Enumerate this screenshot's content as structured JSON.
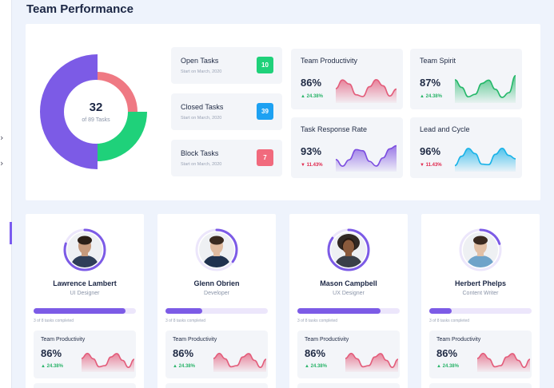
{
  "page": {
    "title": "Team Performance"
  },
  "summary": {
    "completed": "32",
    "of_label": "of 89 Tasks",
    "segments": [
      {
        "name": "purple",
        "color": "#7c5be6",
        "start_deg": 180,
        "end_deg": 360
      },
      {
        "name": "red",
        "color": "#ef7983",
        "start_deg": 0,
        "end_deg": 90
      },
      {
        "name": "green",
        "color": "#1fd17a",
        "start_deg": 90,
        "end_deg": 180
      }
    ]
  },
  "tasks": [
    {
      "title": "Open Tasks",
      "sub": "Start on March, 2020",
      "count": "10",
      "color": "#1fd17a"
    },
    {
      "title": "Closed Tasks",
      "sub": "Start on March, 2020",
      "count": "39",
      "color": "#1da1f2"
    },
    {
      "title": "Block Tasks",
      "sub": "Start on March, 2020",
      "count": "7",
      "color": "#f16a7d"
    }
  ],
  "stats": [
    {
      "title": "Team Productivity",
      "value": "86%",
      "change": "24.38%",
      "trend": "up",
      "color": "#e35d7b"
    },
    {
      "title": "Team Spirit",
      "value": "87%",
      "change": "24.38%",
      "trend": "up",
      "color": "#25b86a"
    },
    {
      "title": "Task Response Rate",
      "value": "93%",
      "change": "11.43%",
      "trend": "down",
      "color": "#7c4ee0"
    },
    {
      "title": "Lead and Cycle",
      "value": "96%",
      "change": "11.43%",
      "trend": "down",
      "color": "#1ab3e8"
    }
  ],
  "members": [
    {
      "name": "Lawrence Lambert",
      "role": "UI Designer",
      "tasks": "3 of 8 tasks completed",
      "progress": 0.9,
      "ring": 0.8,
      "stat_title": "Team Productivity",
      "stat_value": "86%",
      "stat_change": "24.38%",
      "skin": "#c69a7d",
      "hair": "#2b1f18",
      "shirt": "#2f3e58"
    },
    {
      "name": "Glenn Obrien",
      "role": "Developer",
      "tasks": "3 of 8 tasks completed",
      "progress": 0.36,
      "ring": 0.35,
      "stat_title": "Team Productivity",
      "stat_value": "86%",
      "stat_change": "24.38%",
      "skin": "#e0bba0",
      "hair": "#3a2a20",
      "shirt": "#20324f"
    },
    {
      "name": "Mason Campbell",
      "role": "UX Designer",
      "tasks": "3 of 8 tasks completed",
      "progress": 0.81,
      "ring": 0.85,
      "stat_title": "Team Productivity",
      "stat_value": "86%",
      "stat_change": "24.38%",
      "skin": "#8a5a3c",
      "hair": "#1c120c",
      "shirt": "#3a3f48"
    },
    {
      "name": "Herbert Phelps",
      "role": "Content Writer",
      "tasks": "3 of 8 tasks completed",
      "progress": 0.22,
      "ring": 0.2,
      "stat_title": "Team Productivity",
      "stat_value": "86%",
      "stat_change": "24.38%",
      "skin": "#e2c0a6",
      "hair": "#3b2a20",
      "shirt": "#6fa3c9"
    }
  ]
}
